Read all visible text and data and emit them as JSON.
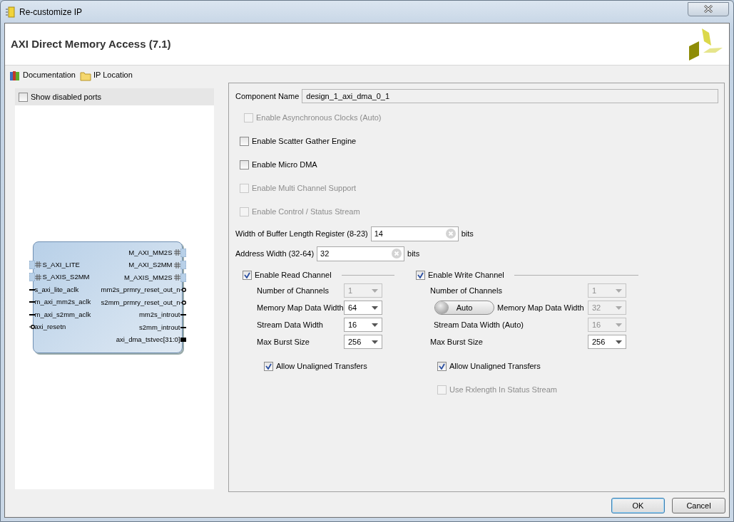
{
  "window": {
    "title": "Re-customize IP"
  },
  "header": {
    "title": "AXI Direct Memory Access (7.1)"
  },
  "toolbar": [
    {
      "label": "Documentation",
      "kind": "books"
    },
    {
      "label": "IP Location",
      "kind": "folder"
    }
  ],
  "symbol_panel": {
    "show_disabled_ports": {
      "label": "Show disabled ports",
      "checked": false
    },
    "left_ports": [
      {
        "name": "S_AXI_LITE",
        "kind": "bus"
      },
      {
        "name": "S_AXIS_S2MM",
        "kind": "bus"
      },
      {
        "name": "s_axi_lite_aclk",
        "kind": "wire"
      },
      {
        "name": "m_axi_mm2s_aclk",
        "kind": "wire"
      },
      {
        "name": "m_axi_s2mm_aclk",
        "kind": "wire"
      },
      {
        "name": "axi_resetn",
        "kind": "reset"
      }
    ],
    "right_ports": [
      {
        "name": "M_AXI_MM2S",
        "kind": "bus"
      },
      {
        "name": "M_AXI_S2MM",
        "kind": "bus"
      },
      {
        "name": "M_AXIS_MM2S",
        "kind": "bus"
      },
      {
        "name": "mm2s_prmry_reset_out_n",
        "kind": "reset"
      },
      {
        "name": "s2mm_prmry_reset_out_n",
        "kind": "reset"
      },
      {
        "name": "mm2s_introut",
        "kind": "wire"
      },
      {
        "name": "s2mm_introut",
        "kind": "wire"
      },
      {
        "name": "axi_dma_tstvec[31:0]",
        "kind": "vector"
      }
    ]
  },
  "component_name": {
    "label": "Component Name",
    "value": "design_1_axi_dma_0_1"
  },
  "options": [
    {
      "label": "Enable Asynchronous Clocks (Auto)",
      "checked": false,
      "disabled": true
    },
    {
      "label": "Enable Scatter Gather Engine",
      "checked": false,
      "disabled": false
    },
    {
      "label": "Enable Micro DMA",
      "checked": false,
      "disabled": false
    },
    {
      "label": "Enable Multi Channel Support",
      "checked": false,
      "disabled": true
    },
    {
      "label": "Enable Control / Status Stream",
      "checked": false,
      "disabled": true
    }
  ],
  "numeric_fields": [
    {
      "label": "Width of Buffer Length Register (8-23)",
      "value": "14",
      "unit": "bits"
    },
    {
      "label": "Address Width (32-64)",
      "value": "32",
      "unit": "bits"
    }
  ],
  "channels": [
    {
      "label": "Enable Read Channel",
      "checked": true,
      "rows": [
        {
          "label": "Number of Channels",
          "value": "1",
          "disabled": true
        },
        {
          "label": "Memory Map Data Width",
          "value": "64",
          "disabled": false
        },
        {
          "label": "Stream Data Width",
          "value": "16",
          "disabled": false
        },
        {
          "label": "Max Burst Size",
          "value": "256",
          "disabled": false
        }
      ],
      "options": [
        {
          "label": "Allow Unaligned Transfers",
          "checked": true,
          "disabled": false
        }
      ]
    },
    {
      "label": "Enable Write Channel",
      "checked": true,
      "rows": [
        {
          "label": "Number of Channels",
          "value": "1",
          "disabled": true
        },
        {
          "label": "Memory Map Data Width",
          "value": "32",
          "disabled": true,
          "toggle": "Auto"
        },
        {
          "label": "Stream Data Width (Auto)",
          "value": "16",
          "disabled": true
        },
        {
          "label": "Max Burst Size",
          "value": "256",
          "disabled": false
        }
      ],
      "options": [
        {
          "label": "Allow Unaligned Transfers",
          "checked": true,
          "disabled": false
        },
        {
          "label": "Use Rxlength In Status Stream",
          "checked": false,
          "disabled": true
        }
      ]
    }
  ],
  "buttons": [
    {
      "label": "OK",
      "default": true
    },
    {
      "label": "Cancel",
      "default": false
    }
  ]
}
